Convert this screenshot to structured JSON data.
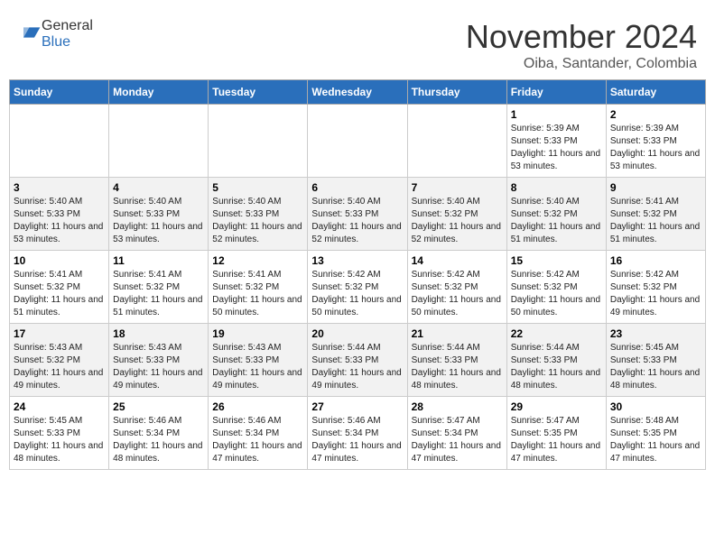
{
  "header": {
    "logo_general": "General",
    "logo_blue": "Blue",
    "month_title": "November 2024",
    "location": "Oiba, Santander, Colombia"
  },
  "days_of_week": [
    "Sunday",
    "Monday",
    "Tuesday",
    "Wednesday",
    "Thursday",
    "Friday",
    "Saturday"
  ],
  "weeks": [
    [
      {
        "day": "",
        "info": ""
      },
      {
        "day": "",
        "info": ""
      },
      {
        "day": "",
        "info": ""
      },
      {
        "day": "",
        "info": ""
      },
      {
        "day": "",
        "info": ""
      },
      {
        "day": "1",
        "info": "Sunrise: 5:39 AM\nSunset: 5:33 PM\nDaylight: 11 hours and 53 minutes."
      },
      {
        "day": "2",
        "info": "Sunrise: 5:39 AM\nSunset: 5:33 PM\nDaylight: 11 hours and 53 minutes."
      }
    ],
    [
      {
        "day": "3",
        "info": "Sunrise: 5:40 AM\nSunset: 5:33 PM\nDaylight: 11 hours and 53 minutes."
      },
      {
        "day": "4",
        "info": "Sunrise: 5:40 AM\nSunset: 5:33 PM\nDaylight: 11 hours and 53 minutes."
      },
      {
        "day": "5",
        "info": "Sunrise: 5:40 AM\nSunset: 5:33 PM\nDaylight: 11 hours and 52 minutes."
      },
      {
        "day": "6",
        "info": "Sunrise: 5:40 AM\nSunset: 5:33 PM\nDaylight: 11 hours and 52 minutes."
      },
      {
        "day": "7",
        "info": "Sunrise: 5:40 AM\nSunset: 5:32 PM\nDaylight: 11 hours and 52 minutes."
      },
      {
        "day": "8",
        "info": "Sunrise: 5:40 AM\nSunset: 5:32 PM\nDaylight: 11 hours and 51 minutes."
      },
      {
        "day": "9",
        "info": "Sunrise: 5:41 AM\nSunset: 5:32 PM\nDaylight: 11 hours and 51 minutes."
      }
    ],
    [
      {
        "day": "10",
        "info": "Sunrise: 5:41 AM\nSunset: 5:32 PM\nDaylight: 11 hours and 51 minutes."
      },
      {
        "day": "11",
        "info": "Sunrise: 5:41 AM\nSunset: 5:32 PM\nDaylight: 11 hours and 51 minutes."
      },
      {
        "day": "12",
        "info": "Sunrise: 5:41 AM\nSunset: 5:32 PM\nDaylight: 11 hours and 50 minutes."
      },
      {
        "day": "13",
        "info": "Sunrise: 5:42 AM\nSunset: 5:32 PM\nDaylight: 11 hours and 50 minutes."
      },
      {
        "day": "14",
        "info": "Sunrise: 5:42 AM\nSunset: 5:32 PM\nDaylight: 11 hours and 50 minutes."
      },
      {
        "day": "15",
        "info": "Sunrise: 5:42 AM\nSunset: 5:32 PM\nDaylight: 11 hours and 50 minutes."
      },
      {
        "day": "16",
        "info": "Sunrise: 5:42 AM\nSunset: 5:32 PM\nDaylight: 11 hours and 49 minutes."
      }
    ],
    [
      {
        "day": "17",
        "info": "Sunrise: 5:43 AM\nSunset: 5:32 PM\nDaylight: 11 hours and 49 minutes."
      },
      {
        "day": "18",
        "info": "Sunrise: 5:43 AM\nSunset: 5:33 PM\nDaylight: 11 hours and 49 minutes."
      },
      {
        "day": "19",
        "info": "Sunrise: 5:43 AM\nSunset: 5:33 PM\nDaylight: 11 hours and 49 minutes."
      },
      {
        "day": "20",
        "info": "Sunrise: 5:44 AM\nSunset: 5:33 PM\nDaylight: 11 hours and 49 minutes."
      },
      {
        "day": "21",
        "info": "Sunrise: 5:44 AM\nSunset: 5:33 PM\nDaylight: 11 hours and 48 minutes."
      },
      {
        "day": "22",
        "info": "Sunrise: 5:44 AM\nSunset: 5:33 PM\nDaylight: 11 hours and 48 minutes."
      },
      {
        "day": "23",
        "info": "Sunrise: 5:45 AM\nSunset: 5:33 PM\nDaylight: 11 hours and 48 minutes."
      }
    ],
    [
      {
        "day": "24",
        "info": "Sunrise: 5:45 AM\nSunset: 5:33 PM\nDaylight: 11 hours and 48 minutes."
      },
      {
        "day": "25",
        "info": "Sunrise: 5:46 AM\nSunset: 5:34 PM\nDaylight: 11 hours and 48 minutes."
      },
      {
        "day": "26",
        "info": "Sunrise: 5:46 AM\nSunset: 5:34 PM\nDaylight: 11 hours and 47 minutes."
      },
      {
        "day": "27",
        "info": "Sunrise: 5:46 AM\nSunset: 5:34 PM\nDaylight: 11 hours and 47 minutes."
      },
      {
        "day": "28",
        "info": "Sunrise: 5:47 AM\nSunset: 5:34 PM\nDaylight: 11 hours and 47 minutes."
      },
      {
        "day": "29",
        "info": "Sunrise: 5:47 AM\nSunset: 5:35 PM\nDaylight: 11 hours and 47 minutes."
      },
      {
        "day": "30",
        "info": "Sunrise: 5:48 AM\nSunset: 5:35 PM\nDaylight: 11 hours and 47 minutes."
      }
    ]
  ]
}
